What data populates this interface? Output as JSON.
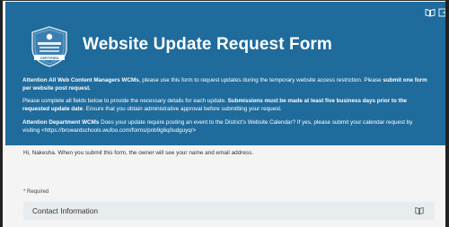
{
  "header": {
    "title": "Website Update Request Form",
    "badge_text": "CERTIFIED",
    "paragraph1": {
      "lead_bold": "Attention All Web Content Managers WCMs",
      "text": ", please use this form to request updates during the temporary website access restriction. Please ",
      "trail_bold": "submit one form per website post request."
    },
    "paragraph2": {
      "text": "Please complete all fields below to provide the necessary details for each update.  ",
      "bold": "Submissions must be made at least five business days prior to the requested update date",
      "trail": ". Ensure that you obtain administrative approval before submitting your request."
    },
    "paragraph3": {
      "lead_bold": "Attention Department WCMs",
      "text": " Does your update require posting an event to the District's Website Calendar? If yes, please submit your calendar request by visiting <",
      "link": "https://browardschools.wufoo.com/forms/pnb9g6q0udguyq/",
      "trail": ">"
    },
    "icons": [
      "immersive-reader-icon",
      "exit-icon"
    ]
  },
  "body": {
    "notice": "Hi, Nakesha. When you submit this form, the owner will see your name and email address.",
    "required_label": "* Required",
    "section_title": "Contact Information",
    "section_icon": "immersive-reader-icon"
  },
  "colors": {
    "header_bg": "#1f6b9c",
    "page_bg": "#f4f4f4",
    "section_bg": "#e7ecef"
  }
}
